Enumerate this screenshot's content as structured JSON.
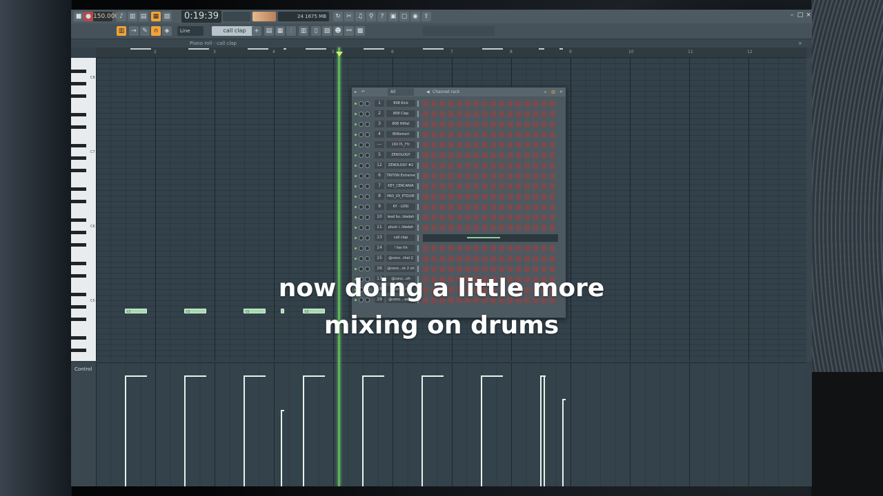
{
  "toolbar": {
    "tempo": "150.000",
    "time": "0:19:39",
    "cpu_label": "",
    "memory": "1675 MB",
    "voices": "24",
    "snap": "Line",
    "pattern": "call clap"
  },
  "piano_roll": {
    "title": "Piano roll - call clap",
    "octave_labels": [
      "C8",
      "C7",
      "C6",
      "C5"
    ],
    "bar_numbers": [
      "2",
      "3",
      "4",
      "5",
      "6",
      "7",
      "8",
      "9",
      "10",
      "11",
      "12"
    ],
    "note_label": "C5",
    "event_editor_label": "Control"
  },
  "channel_rack": {
    "title": "Channel rack",
    "filter": "All",
    "channels": [
      {
        "num": "1",
        "name": "808 Kick"
      },
      {
        "num": "2",
        "name": "808 Clap"
      },
      {
        "num": "3",
        "name": "808 HiHat"
      },
      {
        "num": "4",
        "name": "808amori"
      },
      {
        "num": "---",
        "name": "160 PL_Ffc"
      },
      {
        "num": "5",
        "name": "ZENOLOGY"
      },
      {
        "num": "12",
        "name": "ZENOLOGY #2"
      },
      {
        "num": "6",
        "name": "TRITON Extreme"
      },
      {
        "num": "7",
        "name": "KEY_CERCANIA"
      },
      {
        "num": "8",
        "name": "PAD_03_ETQUIE"
      },
      {
        "num": "9",
        "name": "KY - LOSt"
      },
      {
        "num": "10",
        "name": "lead bu..ldadah"
      },
      {
        "num": "11",
        "name": "pluck i..ldadah"
      },
      {
        "num": "13",
        "name": "call clap"
      },
      {
        "num": "14",
        "name": "! fav hh"
      },
      {
        "num": "15",
        "name": "@conz...thel 2"
      },
      {
        "num": "16",
        "name": "@conz...ck 2 oh"
      },
      {
        "num": "17",
        "name": "@conz...oh"
      },
      {
        "num": "18",
        "name": "@conz...hat"
      },
      {
        "num": "19",
        "name": "@conz....aa10"
      }
    ]
  },
  "caption": {
    "line1": "now doing a little more",
    "line2": "mixing on drums"
  },
  "colors": {
    "accent": "#f2a33a",
    "note": "#a5dcb0",
    "playhead": "#5eb35a",
    "step_on": "#7a4a4c"
  }
}
